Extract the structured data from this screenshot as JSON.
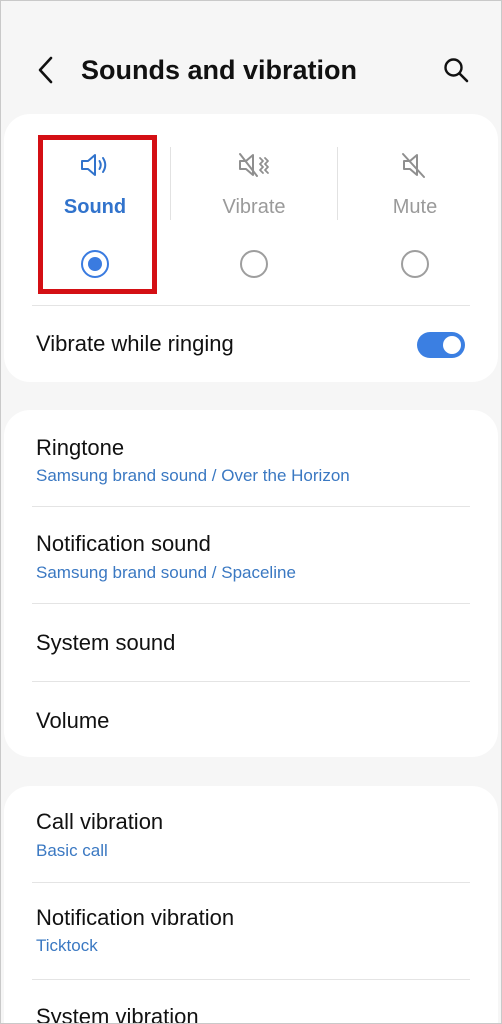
{
  "header": {
    "title": "Sounds and vibration",
    "back_icon": "chevron-left-icon",
    "search_icon": "search-icon"
  },
  "mode_selector": {
    "options": [
      {
        "label": "Sound",
        "icon": "speaker-icon",
        "selected": true
      },
      {
        "label": "Vibrate",
        "icon": "vibrate-icon",
        "selected": false
      },
      {
        "label": "Mute",
        "icon": "mute-icon",
        "selected": false
      }
    ],
    "selected_color": "#3173cc",
    "highlight_color": "#d40f14"
  },
  "vibrate_while_ringing": {
    "label": "Vibrate while ringing",
    "enabled": true,
    "toggle_color": "#3b7fe2"
  },
  "sound_settings": [
    {
      "title": "Ringtone",
      "subtitle": "Samsung brand sound / Over the Horizon"
    },
    {
      "title": "Notification sound",
      "subtitle": "Samsung brand sound / Spaceline"
    },
    {
      "title": "System sound"
    },
    {
      "title": "Volume"
    }
  ],
  "vibration_settings": [
    {
      "title": "Call vibration",
      "subtitle": "Basic call"
    },
    {
      "title": "Notification vibration",
      "subtitle": "Ticktock"
    },
    {
      "title": "System vibration"
    }
  ]
}
